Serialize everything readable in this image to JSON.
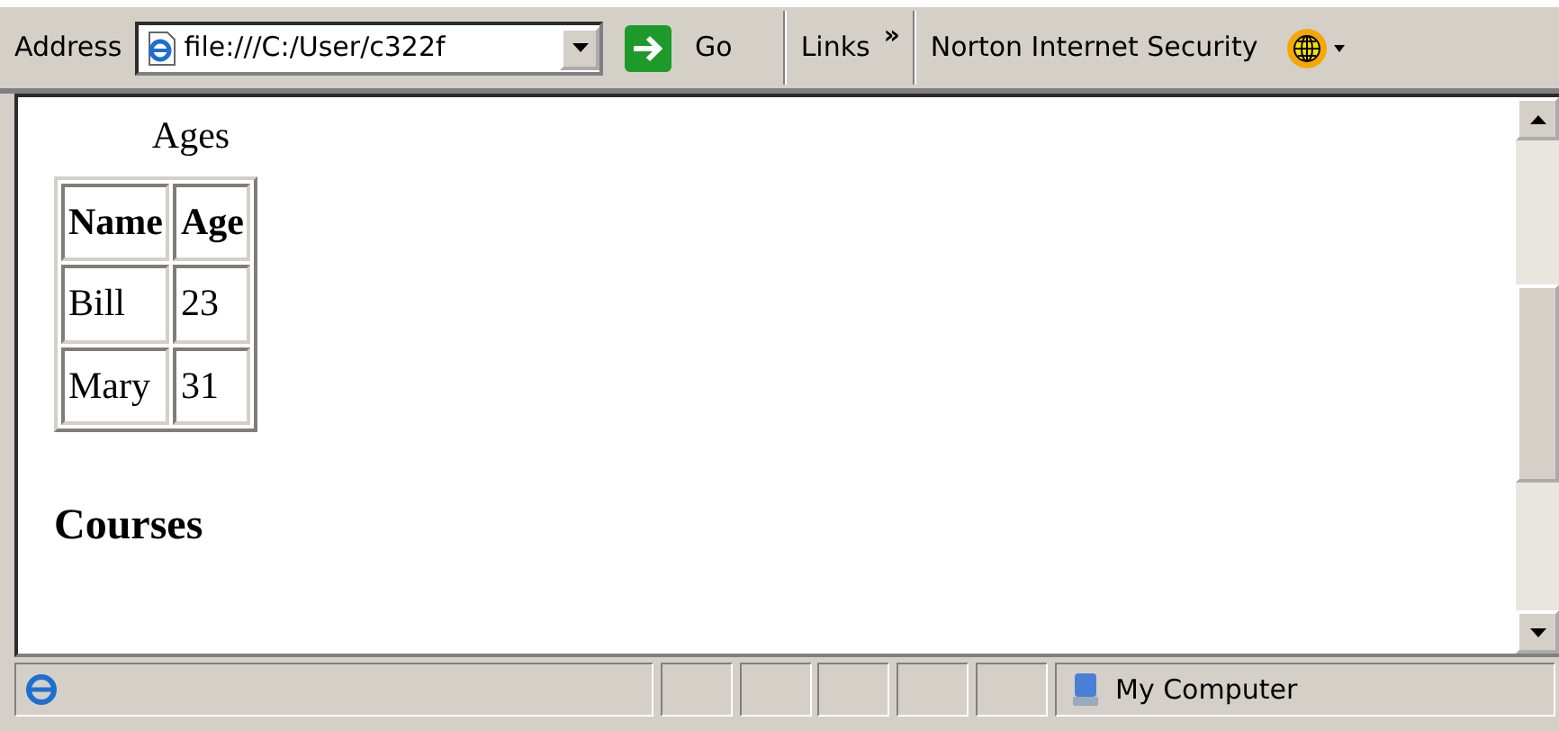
{
  "toolbar": {
    "address_label": "Address",
    "address_value": "file:///C:/User/c322f",
    "go_label": "Go",
    "links_label": "Links",
    "chevron": "»",
    "norton_label": "Norton Internet Security"
  },
  "page": {
    "table": {
      "caption": "Ages",
      "columns": [
        "Name",
        "Age"
      ],
      "rows": [
        [
          "Bill",
          "23"
        ],
        [
          "Mary",
          "31"
        ]
      ]
    },
    "heading": "Courses"
  },
  "status_bar": {
    "zone": "My Computer"
  }
}
